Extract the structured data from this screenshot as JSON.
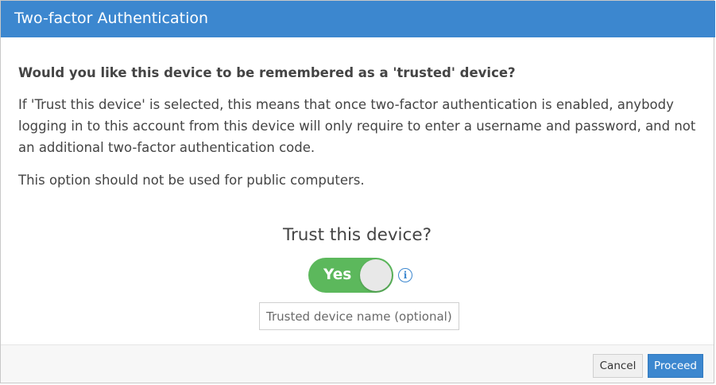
{
  "dialog": {
    "title": "Two-factor Authentication",
    "question": "Would you like this device to be remembered as a 'trusted' device?",
    "description": "If 'Trust this device' is selected, this means that once two-factor authentication is enabled, anybody logging in to this account from this device will only require to enter a username and password, and not an additional two-factor authentication code.",
    "warning": "This option should not be used for public computers.",
    "trust_label": "Trust this device?",
    "toggle": {
      "label": "Yes",
      "state": "on",
      "color": "#5cb85c"
    },
    "info_icon": "info-icon",
    "device_name": {
      "placeholder": "Trusted device name (optional)",
      "value": ""
    },
    "buttons": {
      "cancel": "Cancel",
      "proceed": "Proceed"
    },
    "colors": {
      "header": "#3c87cf",
      "primary": "#3c87cf"
    }
  }
}
